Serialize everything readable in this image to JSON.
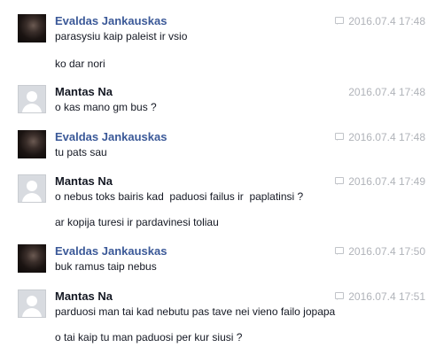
{
  "messages": [
    {
      "sender": "Evaldas Jankauskas",
      "timestamp": "2016.07.4 17:48",
      "show_icon": true,
      "lines": [
        "parasysiu kaip paleist ir vsio",
        "ko dar nori"
      ]
    },
    {
      "sender": "Mantas Na",
      "timestamp": "2016.07.4 17:48",
      "show_icon": false,
      "lines": [
        "o kas mano gm bus ?"
      ]
    },
    {
      "sender": "Evaldas Jankauskas",
      "timestamp": "2016.07.4 17:48",
      "show_icon": true,
      "lines": [
        "tu pats sau"
      ]
    },
    {
      "sender": "Mantas Na",
      "timestamp": "2016.07.4 17:49",
      "show_icon": true,
      "lines": [
        "o nebus toks bairis kad  paduosi failus ir  paplatinsi ?",
        "ar kopija turesi ir pardavinesi toliau"
      ]
    },
    {
      "sender": "Evaldas Jankauskas",
      "timestamp": "2016.07.4 17:50",
      "show_icon": true,
      "lines": [
        "buk ramus taip nebus"
      ]
    },
    {
      "sender": "Mantas Na",
      "timestamp": "2016.07.4 17:51",
      "show_icon": true,
      "lines": [
        "parduosi man tai kad nebutu pas tave nei vieno failo jopapa",
        "o tai kaip tu man paduosi per kur siusi ?"
      ]
    }
  ]
}
